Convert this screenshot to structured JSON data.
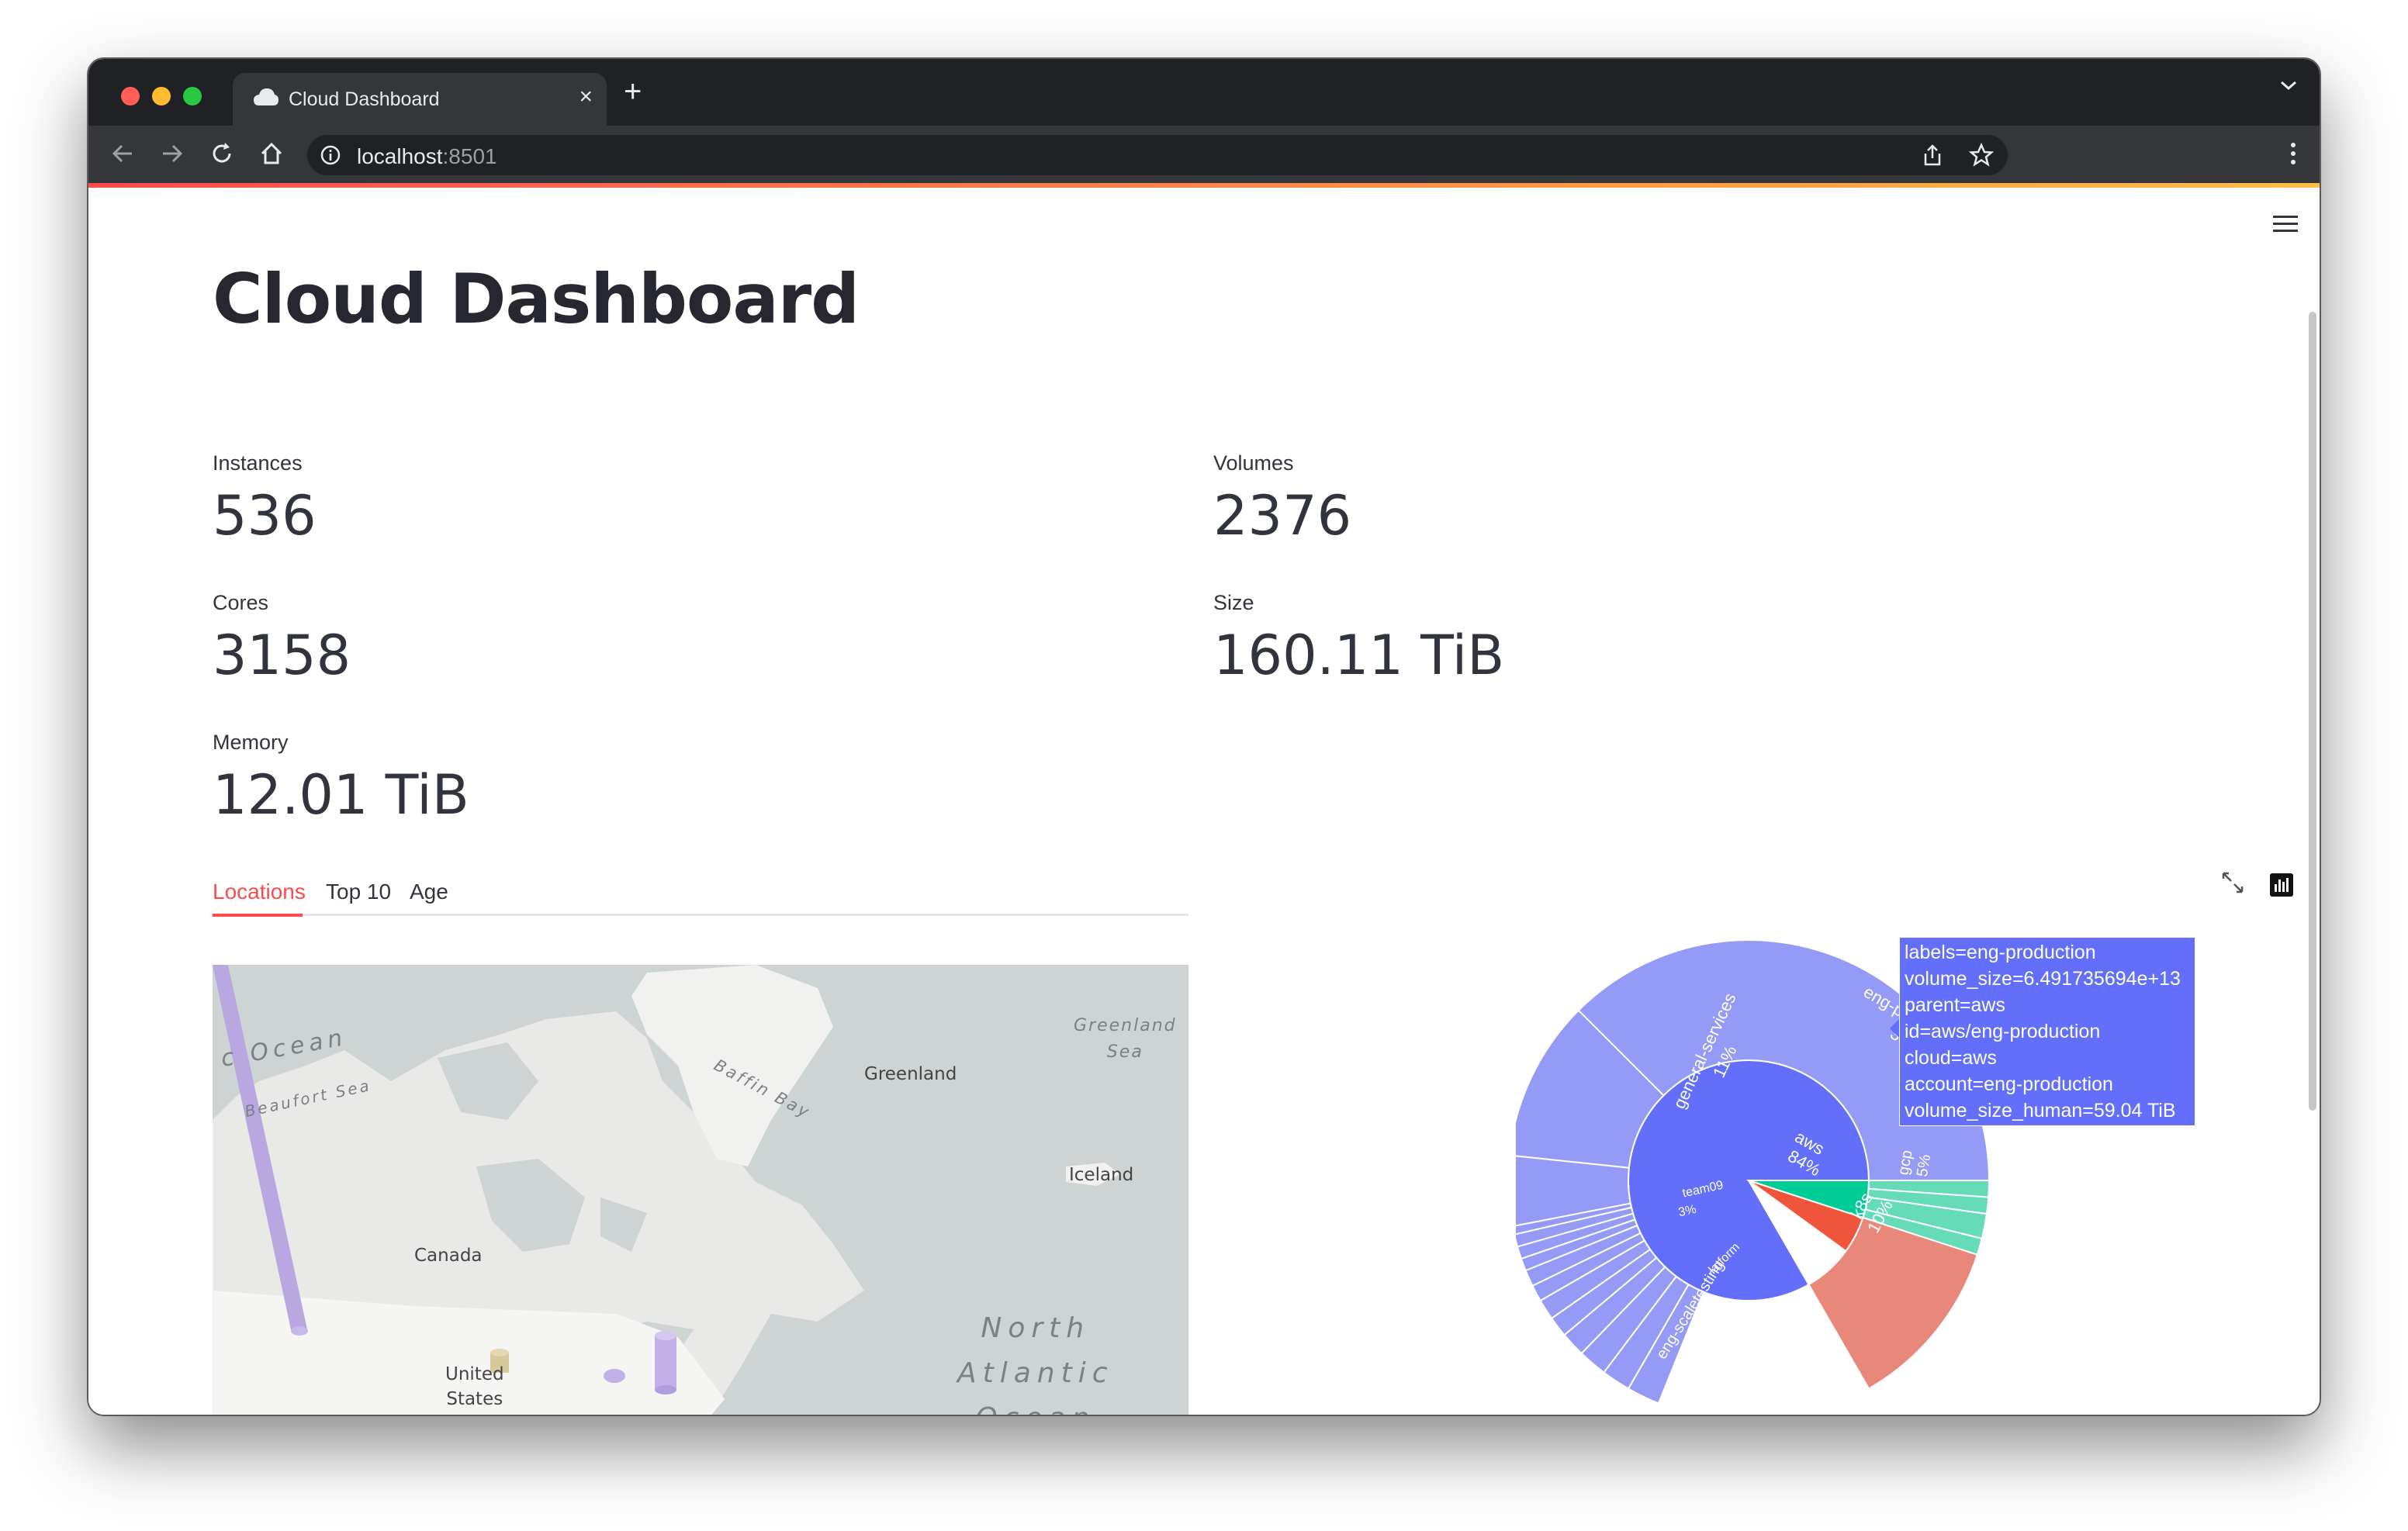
{
  "browser": {
    "tab_title": "Cloud Dashboard",
    "url_host": "localhost",
    "url_port": ":8501"
  },
  "page": {
    "title": "Cloud Dashboard"
  },
  "metrics": {
    "instances": {
      "label": "Instances",
      "value": "536"
    },
    "volumes": {
      "label": "Volumes",
      "value": "2376"
    },
    "cores": {
      "label": "Cores",
      "value": "3158"
    },
    "size": {
      "label": "Size",
      "value": "160.11 TiB"
    },
    "memory": {
      "label": "Memory",
      "value": "12.01 TiB"
    }
  },
  "tabs": [
    {
      "label": "Locations",
      "active": true
    },
    {
      "label": "Top 10",
      "active": false
    },
    {
      "label": "Age",
      "active": false
    }
  ],
  "map": {
    "labels": {
      "greenland": "Greenland",
      "greenland_sea": "Greenland\nSea",
      "canada": "Canada",
      "united_states": "United\nStates",
      "iceland": "Iceland",
      "baffin_bay": "Baffin Bay",
      "beaufort_sea": "Beaufort Sea",
      "arctic_ocean": "c Ocean",
      "north_atlantic": "North\nAtlantic\nOcean"
    }
  },
  "sunburst": {
    "inner": [
      {
        "label": "aws",
        "pct": "84%"
      },
      {
        "label": "k8s",
        "pct": "10%"
      },
      {
        "label": "gcp",
        "pct": "5%"
      }
    ],
    "outer": [
      {
        "label": "eng-production",
        "pct": "37%"
      },
      {
        "label": "general-services",
        "pct": "11%"
      },
      {
        "label": "eng-scaletesting",
        "pct": "6%"
      },
      {
        "label": "team09",
        "pct": "3%"
      }
    ],
    "small_labels": {
      "platform": "latform",
      "scala": "scala"
    },
    "colors": {
      "aws": "#636efa",
      "aws_children": "#939bf6",
      "k8s": "#ef553b",
      "k8s_children": "#e8887a",
      "gcp": "#00cc96",
      "gcp_children": "#66dbb8"
    }
  },
  "hover_label": {
    "lines": [
      "labels=eng-production",
      "volume_size=6.491735694e+13",
      "parent=aws",
      "id=aws/eng-production",
      "cloud=aws",
      "account=eng-production",
      "volume_size_human=59.04 TiB"
    ]
  }
}
